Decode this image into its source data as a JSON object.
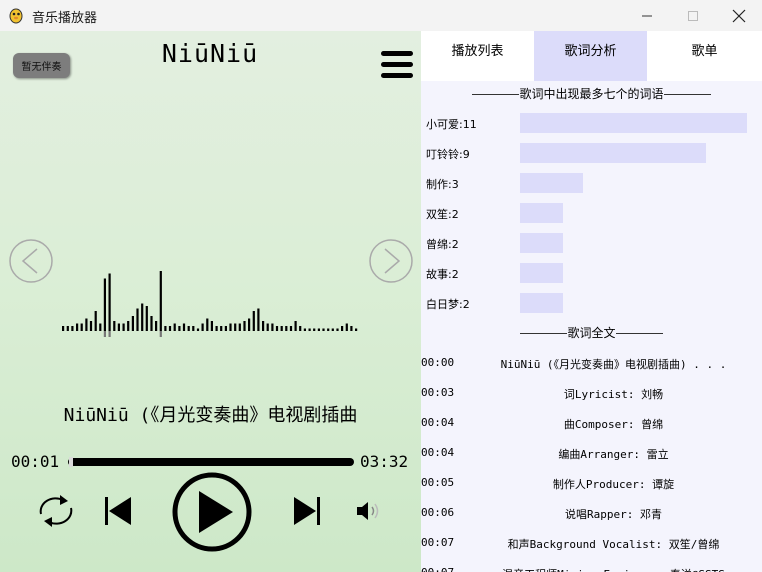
{
  "window": {
    "title": "音乐播放器",
    "controls": {
      "minimize_icon": "minimize-icon",
      "maximize_icon": "maximize-icon",
      "close_icon": "close-icon"
    }
  },
  "player": {
    "accompaniment_button": "暂无伴奏",
    "song_short_title": "NiūNiū",
    "song_full_title": "NiūNiū (《月光变奏曲》电视剧插曲",
    "current_time": "00:01",
    "total_time": "03:32",
    "progress": 0.005,
    "icons": {
      "menu": "menu-icon",
      "prev_song": "chevron-left-icon",
      "next_song": "chevron-right-icon",
      "loop": "loop-icon",
      "previous": "skip-previous-icon",
      "play": "play-icon",
      "next": "skip-next-icon",
      "volume": "volume-icon"
    },
    "spectrum_levels": [
      2,
      2,
      2,
      3,
      3,
      5,
      4,
      8,
      3,
      21,
      23,
      4,
      3,
      3,
      4,
      6,
      9,
      11,
      10,
      6,
      4,
      24,
      2,
      2,
      3,
      2,
      3,
      2,
      2,
      1,
      3,
      5,
      4,
      2,
      2,
      2,
      3,
      3,
      3,
      4,
      5,
      8,
      9,
      4,
      3,
      3,
      2,
      2,
      2,
      2,
      4,
      2,
      1,
      1,
      1,
      1,
      1,
      1,
      1,
      1,
      2,
      3,
      2,
      1
    ]
  },
  "tabs": [
    {
      "label": "播放列表",
      "active": false
    },
    {
      "label": "歌词分析",
      "active": true
    },
    {
      "label": "歌单",
      "active": false
    }
  ],
  "analysis": {
    "top_words_heading": "歌词中出现最多七个的词语",
    "top_words": [
      {
        "label": "小可爱:11",
        "count": 11
      },
      {
        "label": "叮铃铃:9",
        "count": 9
      },
      {
        "label": "制作:3",
        "count": 3
      },
      {
        "label": "双笙:2",
        "count": 2
      },
      {
        "label": "曾绵:2",
        "count": 2
      },
      {
        "label": "故事:2",
        "count": 2
      },
      {
        "label": "白日梦:2",
        "count": 2
      }
    ],
    "full_lyrics_heading": "歌词全文",
    "lyrics": [
      {
        "time": "00:00",
        "text": "NiūNiū (《月光变奏曲》电视剧插曲) . . ."
      },
      {
        "time": "00:03",
        "text": "词Lyricist: 刘畅"
      },
      {
        "time": "00:04",
        "text": "曲Composer: 曾绵"
      },
      {
        "time": "00:04",
        "text": "编曲Arranger: 雷立"
      },
      {
        "time": "00:05",
        "text": "制作人Producer: 谭旋"
      },
      {
        "time": "00:06",
        "text": "说唱Rapper: 邓青"
      },
      {
        "time": "00:07",
        "text": "和声Background Vocalist: 双笙/曾绵"
      },
      {
        "time": "00:07",
        "text": "混音工程师Mixing Engineer: 秦洋@SSTS"
      }
    ]
  },
  "colors": {
    "tab_active": "#dcdcfa",
    "bar": "#dcdcfa",
    "panel_bg": "#f4f4fd",
    "player_bg": "#dbeed6"
  }
}
